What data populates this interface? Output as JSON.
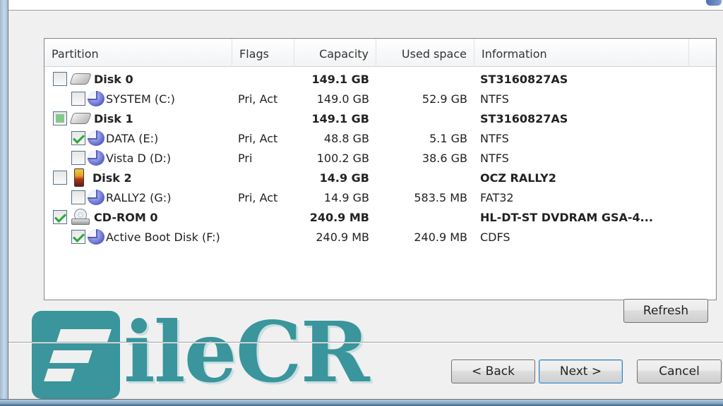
{
  "list": {
    "columns": {
      "partition": "Partition",
      "flags": "Flags",
      "capacity": "Capacity",
      "used_space": "Used space",
      "information": "Information"
    },
    "rows": [
      {
        "level": 0,
        "type": "disk",
        "icon": "hard-disk-icon",
        "checkbox": "unchecked",
        "name": "Disk 0",
        "flags": "",
        "capacity": "149.1 GB",
        "used": "",
        "info": "ST3160827AS"
      },
      {
        "level": 1,
        "type": "partition",
        "icon": "partition-icon",
        "checkbox": "unchecked",
        "name": "SYSTEM (C:)",
        "flags": "Pri, Act",
        "capacity": "149.0 GB",
        "used": "52.9 GB",
        "info": "NTFS"
      },
      {
        "level": 0,
        "type": "disk",
        "icon": "hard-disk-icon",
        "checkbox": "partial",
        "name": "Disk 1",
        "flags": "",
        "capacity": "149.1 GB",
        "used": "",
        "info": "ST3160827AS"
      },
      {
        "level": 1,
        "type": "partition",
        "icon": "partition-icon",
        "checkbox": "checked",
        "name": "DATA (E:)",
        "flags": "Pri, Act",
        "capacity": "48.8 GB",
        "used": "5.1 GB",
        "info": "NTFS"
      },
      {
        "level": 1,
        "type": "partition",
        "icon": "partition-icon",
        "checkbox": "unchecked",
        "name": "Vista D (D:)",
        "flags": "Pri",
        "capacity": "100.2 GB",
        "used": "38.6 GB",
        "info": "NTFS"
      },
      {
        "level": 0,
        "type": "disk",
        "icon": "usb-drive-icon",
        "checkbox": "unchecked",
        "name": "Disk 2",
        "flags": "",
        "capacity": "14.9 GB",
        "used": "",
        "info": "OCZ RALLY2"
      },
      {
        "level": 1,
        "type": "partition",
        "icon": "partition-icon",
        "checkbox": "unchecked",
        "name": "RALLY2 (G:)",
        "flags": "Pri, Act",
        "capacity": "14.9 GB",
        "used": "583.5 MB",
        "info": "FAT32"
      },
      {
        "level": 0,
        "type": "disk",
        "icon": "cd-rom-icon",
        "checkbox": "checked",
        "name": "CD-ROM 0",
        "flags": "",
        "capacity": "240.9 MB",
        "used": "",
        "info": "HL-DT-ST DVDRAM GSA-4..."
      },
      {
        "level": 1,
        "type": "partition",
        "icon": "partition-icon",
        "checkbox": "checked",
        "name": " Active Boot Disk (F:)",
        "flags": "",
        "capacity": "240.9 MB",
        "used": "240.9 MB",
        "info": "CDFS"
      }
    ]
  },
  "buttons": {
    "refresh": "Refresh",
    "back": "< Back",
    "next": "Next >",
    "cancel": "Cancel"
  },
  "watermark": {
    "text": "ileCR"
  },
  "colors": {
    "watermark": "#3a959c",
    "check_green": "#2aa838",
    "default_button_border": "#3c7fb1"
  }
}
